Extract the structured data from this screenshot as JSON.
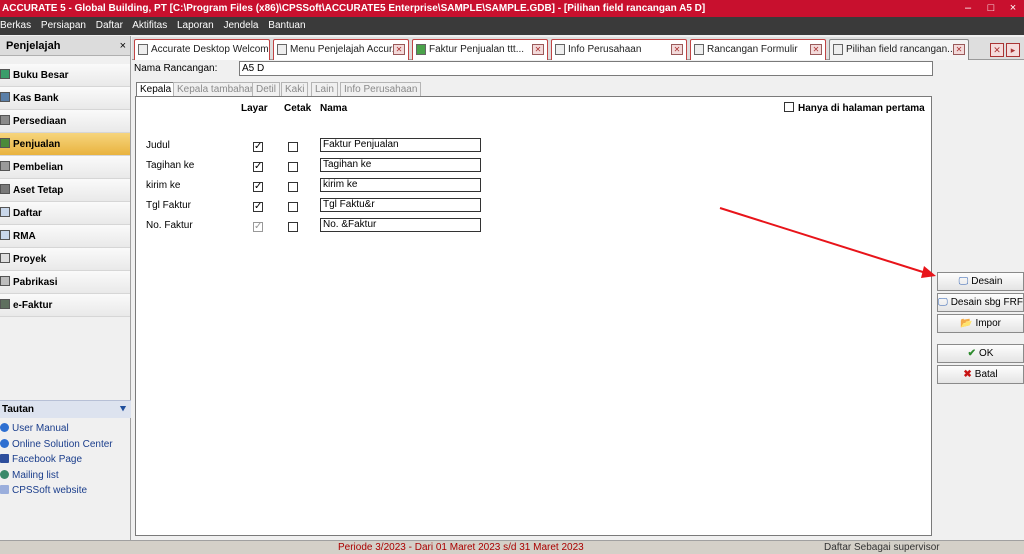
{
  "window": {
    "title": "ACCURATE 5  - Global Building, PT  [C:\\Program Files (x86)\\CPSSoft\\ACCURATE5 Enterprise\\SAMPLE\\SAMPLE.GDB] - [Pilihan field rancangan A5 D]",
    "controls": [
      "–",
      "□",
      "×"
    ]
  },
  "menu": [
    "Berkas",
    "Persiapan",
    "Daftar",
    "Aktifitas",
    "Laporan",
    "Jendela",
    "Bantuan"
  ],
  "sidebar": {
    "title": "Penjelajah",
    "close": "×",
    "items": [
      {
        "label": "Buku Besar",
        "active": false
      },
      {
        "label": "Kas Bank",
        "active": false
      },
      {
        "label": "Persediaan",
        "active": false
      },
      {
        "label": "Penjualan",
        "active": true
      },
      {
        "label": "Pembelian",
        "active": false
      },
      {
        "label": "Aset Tetap",
        "active": false
      },
      {
        "label": "Daftar",
        "active": false
      },
      {
        "label": "RMA",
        "active": false
      },
      {
        "label": "Proyek",
        "active": false
      },
      {
        "label": "Pabrikasi",
        "active": false
      },
      {
        "label": "e-Faktur",
        "active": false
      }
    ],
    "tautan": {
      "title": "Tautan",
      "links": [
        "User Manual",
        "Online Solution Center",
        "Facebook Page",
        "Mailing list",
        "CPSSoft website"
      ]
    }
  },
  "doc_tabs": [
    {
      "label": "Accurate Desktop Welcome..."
    },
    {
      "label": "Menu Penjelajah Accur..."
    },
    {
      "label": "Faktur Penjualan ttt..."
    },
    {
      "label": "Info Perusahaan"
    },
    {
      "label": "Rancangan Formulir"
    },
    {
      "label": "Pilihan field rancangan..."
    }
  ],
  "form": {
    "nama_rancangan_label": "Nama Rancangan:",
    "nama_rancangan_value": "A5 D",
    "subtabs": [
      "Kepala",
      "Kepala tambahan",
      "Detil",
      "Kaki",
      "Lain",
      "Info Perusahaan"
    ],
    "columns": {
      "layar": "Layar",
      "cetak": "Cetak",
      "nama": "Nama"
    },
    "only_first_page": {
      "label": "Hanya di halaman pertama",
      "checked": false
    },
    "rows": [
      {
        "label": "Judul",
        "layar": true,
        "cetak": false,
        "nama": "Faktur Penjualan"
      },
      {
        "label": "Tagihan ke",
        "layar": true,
        "cetak": false,
        "nama": "Tagihan ke"
      },
      {
        "label": "kirim ke",
        "layar": true,
        "cetak": false,
        "nama": "kirim ke"
      },
      {
        "label": "Tgl Faktur",
        "layar": true,
        "cetak": false,
        "nama": "Tgl Faktu&r"
      },
      {
        "label": "No. Faktur",
        "layar": true,
        "cetak": false,
        "nama": "No. &Faktur"
      }
    ]
  },
  "buttons": {
    "desain": "Desain",
    "desain_frf": "Desain sbg FRF",
    "impor": "Impor",
    "ok": "OK",
    "batal": "Batal"
  },
  "status": {
    "periode": "Periode 3/2023 - Dari 01 Maret 2023 s/d 31 Maret 2023",
    "user": "Daftar Sebagai supervisor"
  },
  "colors": {
    "titlebar": "#c8102e",
    "menubar": "#3a3a3a",
    "active_item": "#e9b33f",
    "arrow": "#e8141a"
  }
}
